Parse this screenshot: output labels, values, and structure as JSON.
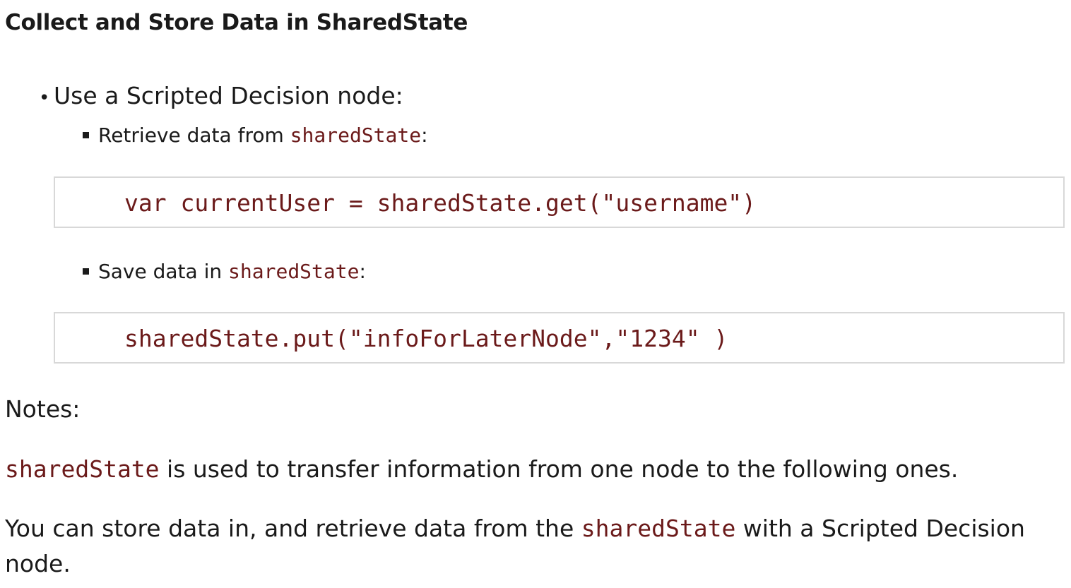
{
  "title": "Collect and Store Data in SharedState",
  "bullet_main": {
    "marker": "•",
    "text": "Use a Scripted Decision node:"
  },
  "retrieve": {
    "prefix": "Retrieve data from ",
    "code": "sharedState",
    "suffix": ":",
    "code_block": "var currentUser = sharedState.get(\"username\")"
  },
  "save": {
    "prefix": "Save data in ",
    "code": "sharedState",
    "suffix": ":",
    "code_block": "sharedState.put(\"infoForLaterNode\",\"1234\" )"
  },
  "notes": {
    "heading": "Notes:",
    "para1": {
      "code": "sharedState",
      "text": " is used to transfer information from one node to the following ones."
    },
    "para2": {
      "prefix": "You can store data in, and retrieve data from the ",
      "code": "sharedState",
      "suffix": " with a Scripted Decision node."
    }
  },
  "colors": {
    "code_text": "#6b1a1a",
    "code_block_border": "#d8d8d8",
    "body_text": "#1a1a1a"
  }
}
